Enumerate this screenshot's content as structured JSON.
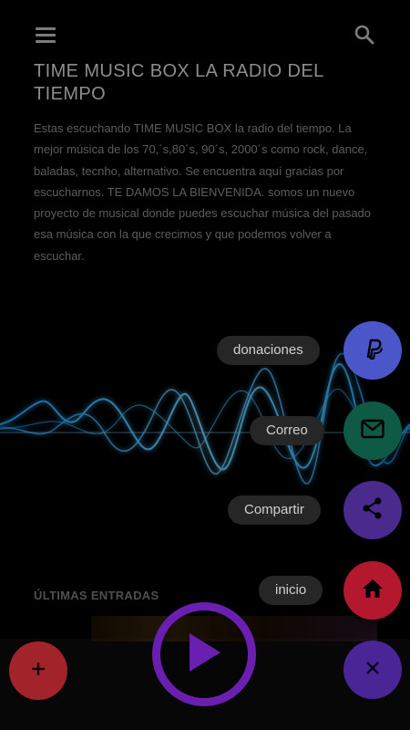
{
  "header": {
    "menu_icon": "hamburger-menu-icon",
    "search_icon": "search-icon"
  },
  "content": {
    "title": "TIME MUSIC BOX LA RADIO DEL TIEMPO",
    "description": "Estas escuchando TIME MUSIC BOX la radio del tiempo. La mejor música de los 70,´s,80´s, 90´s, 2000´s como rock, dance, baladas, tecnho, alternativo. Se encuentra aquí gracias por escucharnos. TE DAMOS LA BIENVENIDA. somos un nuevo proyecto de musical donde puedes escuchar música del pasado esa música con la que crecimos y que podemos volver a escuchar.",
    "section_label": "ÚLTIMAS ENTRADAS"
  },
  "fab_menu": {
    "items": [
      {
        "label": "donaciones",
        "icon": "paypal-icon",
        "color": "#4b57c9"
      },
      {
        "label": "Correo",
        "icon": "mail-icon",
        "color": "#0f5a44"
      },
      {
        "label": "Compartir",
        "icon": "share-icon",
        "color": "#4a2a8c"
      },
      {
        "label": "inicio",
        "icon": "home-icon",
        "color": "#b3182f"
      }
    ],
    "close_icon": "close-icon",
    "close_color": "#4a2596"
  },
  "player": {
    "play_icon": "play-icon",
    "add_icon": "plus-icon",
    "add_color": "#a3232a",
    "play_color": "#6a1fb0"
  }
}
